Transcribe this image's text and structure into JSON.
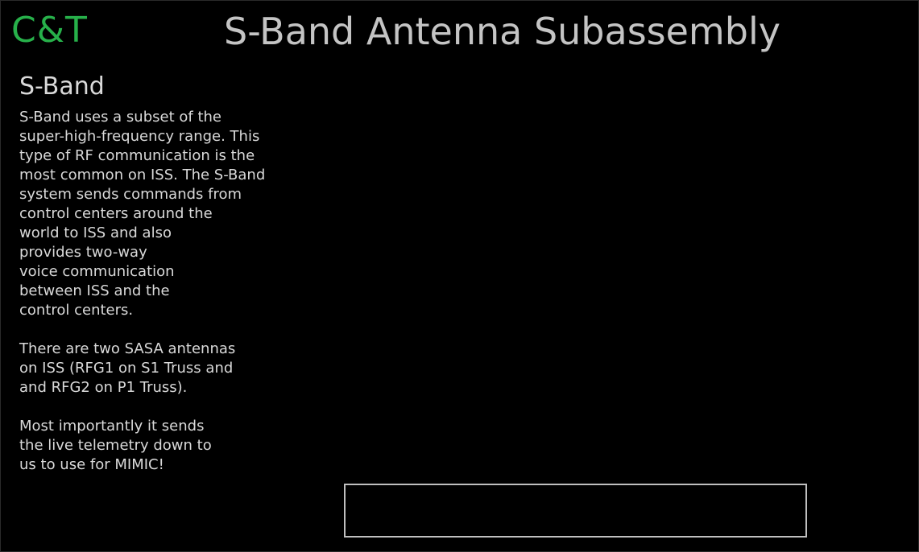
{
  "header": {
    "logo_text": "C&T",
    "title": "S-Band Antenna Subassembly"
  },
  "info_panel": {
    "heading": "S-Band",
    "paragraphs": [
      {
        "lines": [
          "S-Band uses a subset of the",
          "super-high-frequency range.  This",
          "type of RF communication is the",
          "most common on ISS.  The S-Band",
          "system sends commands from",
          "control centers around the",
          "world to ISS and also",
          "provides two-way",
          "voice communication",
          "between ISS and the",
          "control centers."
        ]
      },
      {
        "lines": [
          "There are two SASA antennas",
          "on ISS (RFG1 on S1 Truss and",
          "and RFG2 on P1 Truss)."
        ]
      },
      {
        "lines": [
          "Most importantly it sends",
          "the live telemetry down to",
          "us to use for MIMIC!"
        ]
      }
    ]
  },
  "status_box": {
    "text": ""
  },
  "colors": {
    "background": "#000000",
    "logo": "#27b04a",
    "title": "#c4c4c4",
    "text": "#d9d9d9",
    "box_border": "#bfbfbf"
  }
}
